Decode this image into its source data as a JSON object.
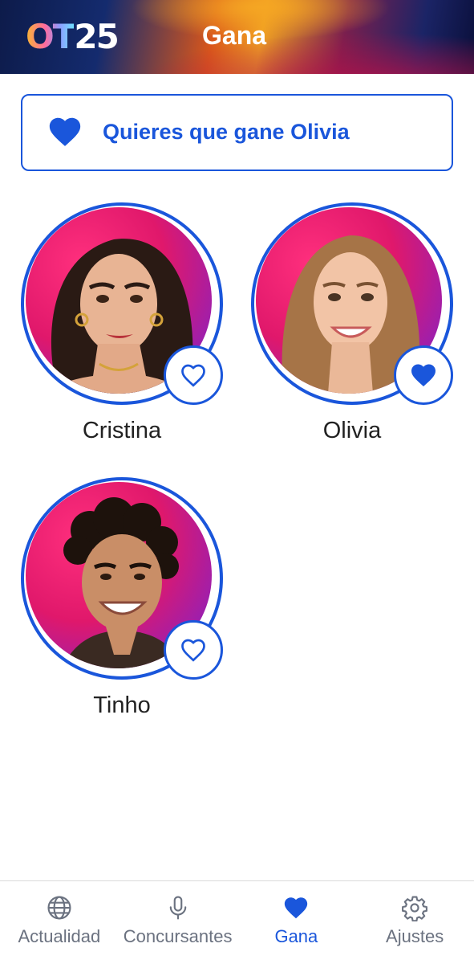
{
  "header": {
    "logo_ot": "OT",
    "logo_num": "25",
    "title": "Gana"
  },
  "banner": {
    "icon": "heart-icon",
    "text": "Quieres que gane Olivia"
  },
  "contestants": [
    {
      "name": "Cristina",
      "favorite": false,
      "icon": "heart-outline-icon"
    },
    {
      "name": "Olivia",
      "favorite": true,
      "icon": "heart-filled-icon"
    },
    {
      "name": "Tinho",
      "favorite": false,
      "icon": "heart-outline-icon"
    }
  ],
  "nav": {
    "items": [
      {
        "label": "Actualidad",
        "icon": "globe-icon",
        "active": false
      },
      {
        "label": "Concursantes",
        "icon": "microphone-icon",
        "active": false
      },
      {
        "label": "Gana",
        "icon": "heart-icon",
        "active": true
      },
      {
        "label": "Ajustes",
        "icon": "gear-icon",
        "active": false
      }
    ]
  },
  "colors": {
    "accent": "#1a56db",
    "text": "#222222",
    "inactive": "#6b7280"
  }
}
